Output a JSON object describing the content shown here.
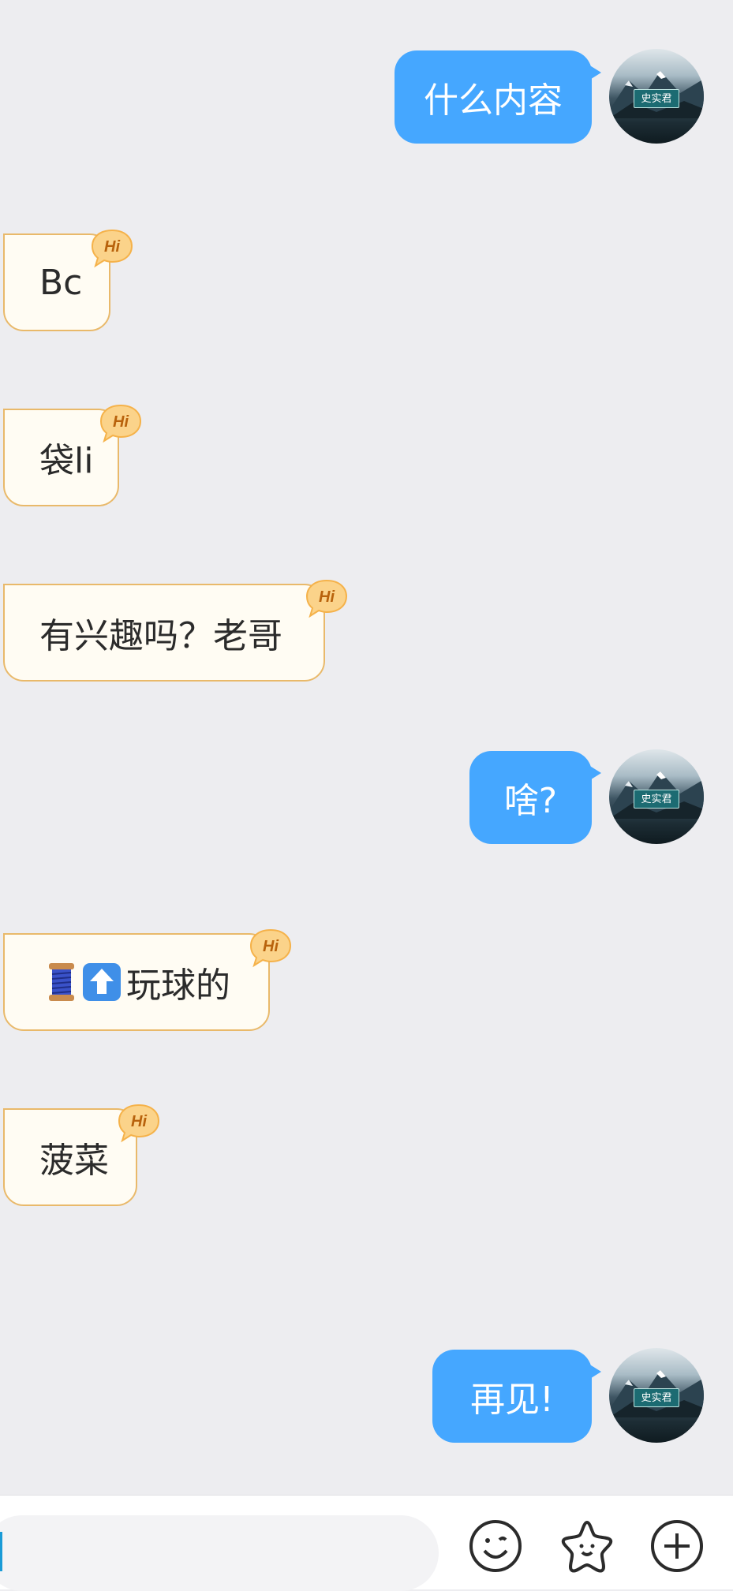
{
  "messages": [
    {
      "side": "out",
      "text": "什么内容",
      "avatar_label": "史实君"
    },
    {
      "side": "in",
      "text": "Bc",
      "badge": "Hi"
    },
    {
      "side": "in",
      "text": "袋li",
      "badge": "Hi"
    },
    {
      "side": "in",
      "text": "有兴趣吗？老哥",
      "badge": "Hi"
    },
    {
      "side": "out",
      "text": "啥?",
      "avatar_label": "史实君"
    },
    {
      "side": "in",
      "emoji": [
        "spool-icon",
        "up-arrow-icon"
      ],
      "text": "玩球的",
      "badge": "Hi"
    },
    {
      "side": "in",
      "text": "菠菜",
      "badge": "Hi"
    },
    {
      "side": "out",
      "text": "再见!",
      "avatar_label": "史实君"
    }
  ],
  "input_bar": {
    "placeholder": "",
    "icons": [
      "emoji-icon",
      "sticker-star-icon",
      "add-plus-icon"
    ]
  },
  "colors": {
    "background": "#ededf0",
    "out_bubble": "#45a7ff",
    "in_bubble": "#fffcf3",
    "in_border": "#e9b96a",
    "badge": "#f6b73c"
  }
}
